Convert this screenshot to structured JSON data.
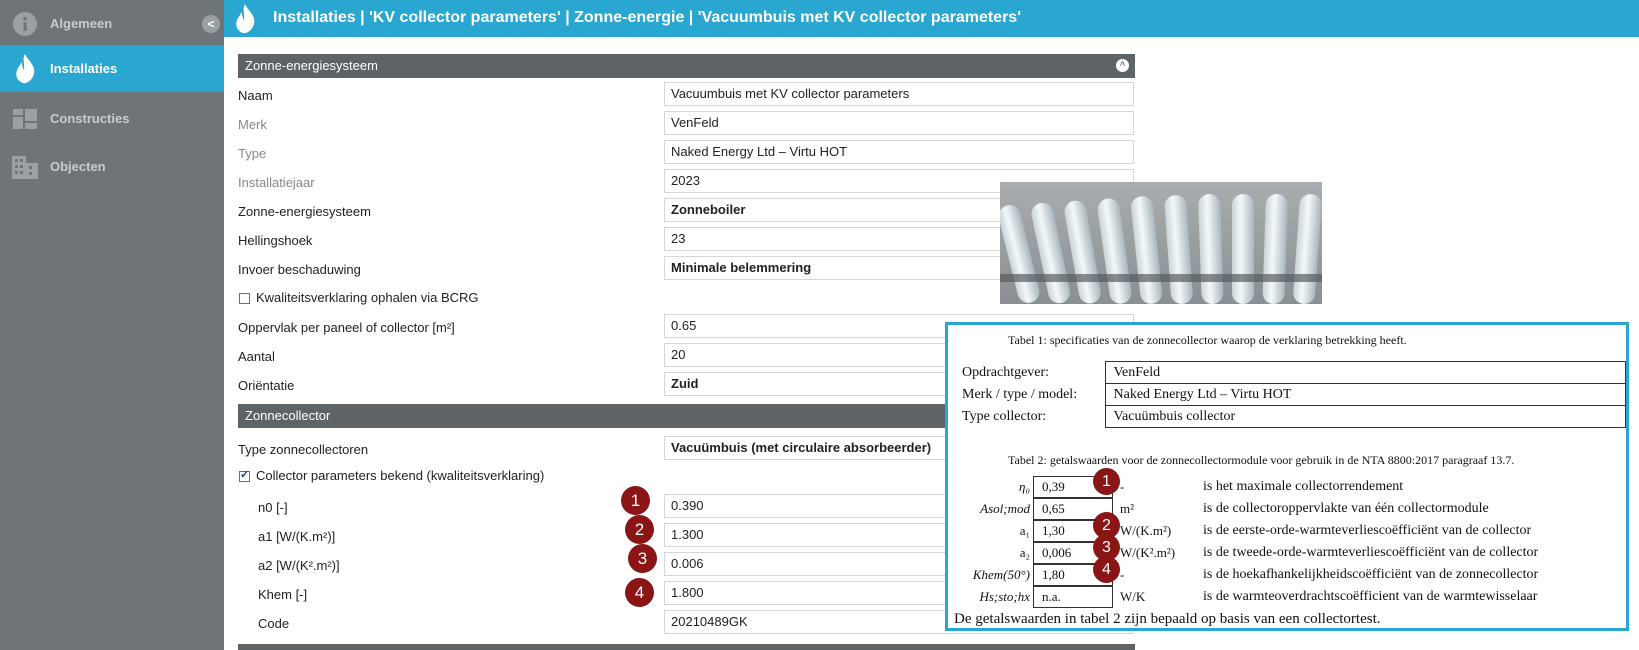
{
  "sidebar": {
    "items": [
      {
        "label": "Algemeen",
        "icon": "info-icon"
      },
      {
        "label": "Installaties",
        "icon": "flame-icon"
      },
      {
        "label": "Constructies",
        "icon": "constructions-icon"
      },
      {
        "label": "Objecten",
        "icon": "building-icon"
      }
    ],
    "collapse_label": "<"
  },
  "header": {
    "title": "Installaties | 'KV collector parameters' | Zonne-energie | 'Vacuumbuis met KV collector parameters'"
  },
  "section1": {
    "title": "Zonne-energiesysteem",
    "collapse_icon": "^",
    "rows": [
      {
        "label": "Naam",
        "value": "Vacuumbuis met KV collector parameters"
      },
      {
        "label": "Merk",
        "value": "VenFeld"
      },
      {
        "label": "Type",
        "value": "Naked Energy Ltd – Virtu HOT"
      },
      {
        "label": "Installatiejaar",
        "value": "2023"
      },
      {
        "label": "Zonne-energiesysteem",
        "value": "Zonneboiler"
      },
      {
        "label": "Hellingshoek",
        "value": "23"
      },
      {
        "label": "Invoer beschaduwing",
        "value": "Minimale belemmering"
      }
    ],
    "checkbox_label": "Kwaliteitsverklaring ophalen via BCRG",
    "rows2": [
      {
        "label": "Oppervlak per paneel of collector [m²]",
        "value": "0.65"
      },
      {
        "label": "Aantal",
        "value": "20"
      },
      {
        "label": "Oriëntatie",
        "value": "Zuid"
      }
    ]
  },
  "section2": {
    "title": "Zonnecollector",
    "type_label": "Type zonnecollectoren",
    "type_value": "Vacuümbuis (met circulaire absorbeerder)",
    "checkbox_label": "Collector parameters bekend (kwaliteitsverklaring)",
    "params": [
      {
        "badge": "1",
        "label": "n0 [-]",
        "value": "0.390"
      },
      {
        "badge": "2",
        "label": "a1 [W/(K.m²)]",
        "value": "1.300"
      },
      {
        "badge": "3",
        "label": "a2 [W/(K².m²)]",
        "value": "0.006"
      },
      {
        "badge": "4",
        "label": "Khem [-]",
        "value": "1.800"
      }
    ],
    "code_label": "Code",
    "code_value": "20210489GK"
  },
  "overlay": {
    "caption1": "Tabel 1: specificaties van de zonnecollector waarop de verklaring betrekking heeft.",
    "table1": [
      {
        "key": "Opdrachtgever:",
        "value": "VenFeld"
      },
      {
        "key": "Merk / type / model:",
        "value": "Naked Energy Ltd – Virtu HOT"
      },
      {
        "key": "Type collector:",
        "value": "Vacuümbuis collector"
      }
    ],
    "caption2": "Tabel 2: getalswaarden voor de zonnecollectormodule voor gebruik in de NTA 8800:2017 paragraaf 13.7.",
    "params": [
      {
        "symbol": "η₀",
        "value": "0,39",
        "unit": "-",
        "badge": "1",
        "desc": "is het maximale collectorrendement"
      },
      {
        "symbol": "Asol;mod",
        "value": "0,65",
        "unit": "m²",
        "badge": "",
        "desc": "is de collectoroppervlakte van één collectormodule"
      },
      {
        "symbol": "a₁",
        "value": "1,30",
        "unit": "W/(K.m²)",
        "badge": "2",
        "desc": "is de eerste-orde-warmteverliescoëfficiënt van de collector"
      },
      {
        "symbol": "a₂",
        "value": "0,006",
        "unit": "W/(K².m²)",
        "badge": "3",
        "desc": "is de tweede-orde-warmteverliescoëfficiënt van de collector"
      },
      {
        "symbol": "Khem(50°)",
        "value": "1,80",
        "unit": "-",
        "badge": "4",
        "desc": "is de hoekafhankelijkheidscoëfficiënt van de zonnecollector"
      },
      {
        "symbol": "Hs;sto;hx",
        "value": "n.a.",
        "unit": "W/K",
        "badge": "",
        "desc": "is de warmteoverdrachtscoëfficient van de warmtewisselaar"
      }
    ],
    "footer": "De getalswaarden in tabel 2 zijn bepaald op basis van een collectortest."
  },
  "colors": {
    "accent": "#2aa7d0",
    "sidebar": "#6f7479",
    "section_header": "#5e6368",
    "badge": "#8b1414"
  }
}
